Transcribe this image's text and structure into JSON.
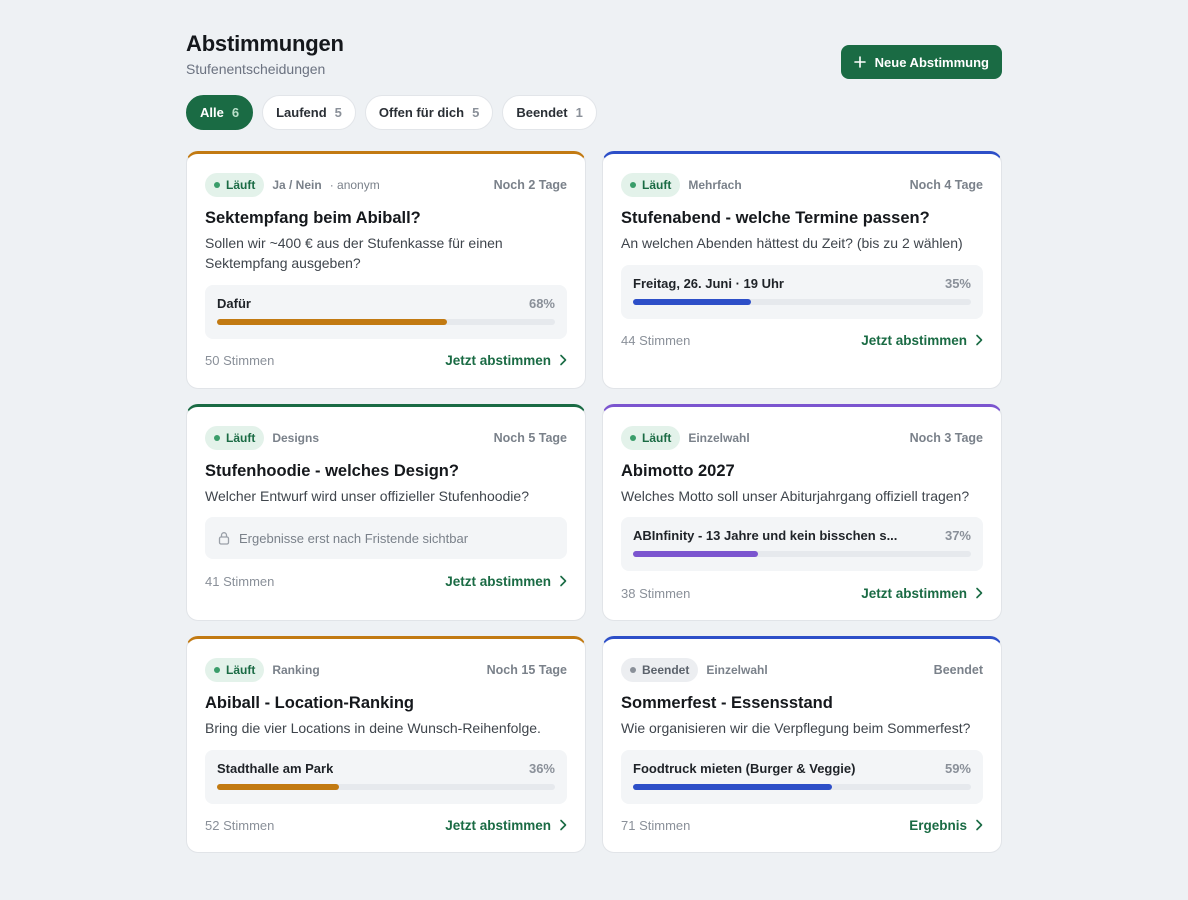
{
  "header": {
    "title": "Abstimmungen",
    "subtitle": "Stufenentscheidungen",
    "new_button": "Neue Abstimmung"
  },
  "filters": [
    {
      "label": "Alle",
      "count": "6",
      "active": true
    },
    {
      "label": "Laufend",
      "count": "5",
      "active": false
    },
    {
      "label": "Offen für dich",
      "count": "5",
      "active": false
    },
    {
      "label": "Beendet",
      "count": "1",
      "active": false
    }
  ],
  "colors": {
    "brand": "#1a6b44",
    "orange": "#c27a12",
    "blue": "#2d4fc8",
    "green": "#1a6b44",
    "purple": "#7b55cf"
  },
  "polls": [
    {
      "status": "Läuft",
      "type": "Ja / Nein",
      "anon": "· anonym",
      "deadline": "Noch 2 Tage",
      "title": "Sektempfang beim Abiball?",
      "description": "Sollen wir ~400 € aus der Stufenkasse für einen Sektempfang ausgeben?",
      "result_label": "Dafür",
      "result_pct": "68%",
      "result_value": 0.68,
      "votes": "50 Stimmen",
      "cta": "Jetzt abstimmen"
    },
    {
      "status": "Läuft",
      "type": "Mehrfach",
      "deadline": "Noch 4 Tage",
      "title": "Stufenabend - welche Termine passen?",
      "description": "An welchen Abenden hättest du Zeit? (bis zu 2 wählen)",
      "result_label": "Freitag, 26. Juni · 19 Uhr",
      "result_pct": "35%",
      "result_value": 0.35,
      "votes": "44 Stimmen",
      "cta": "Jetzt abstimmen"
    },
    {
      "status": "Läuft",
      "type": "Designs",
      "deadline": "Noch 5 Tage",
      "title": "Stufenhoodie - welches Design?",
      "description": "Welcher Entwurf wird unser offizieller Stufenhoodie?",
      "locked_text": "Ergebnisse erst nach Fristende sichtbar",
      "votes": "41 Stimmen",
      "cta": "Jetzt abstimmen"
    },
    {
      "status": "Läuft",
      "type": "Einzelwahl",
      "deadline": "Noch 3 Tage",
      "title": "Abimotto 2027",
      "description": "Welches Motto soll unser Abiturjahrgang offiziell tragen?",
      "result_label": "ABInfinity - 13 Jahre und kein bisschen s...",
      "result_pct": "37%",
      "result_value": 0.37,
      "votes": "38 Stimmen",
      "cta": "Jetzt abstimmen"
    },
    {
      "status": "Läuft",
      "type": "Ranking",
      "deadline": "Noch 15 Tage",
      "title": "Abiball - Location-Ranking",
      "description": "Bring die vier Locations in deine Wunsch-Reihenfolge.",
      "result_label": "Stadthalle am Park",
      "result_pct": "36%",
      "result_value": 0.36,
      "votes": "52 Stimmen",
      "cta": "Jetzt abstimmen"
    },
    {
      "status": "Beendet",
      "type": "Einzelwahl",
      "deadline": "Beendet",
      "title": "Sommerfest - Essensstand",
      "description": "Wie organisieren wir die Verpflegung beim Sommerfest?",
      "result_label": "Foodtruck mieten (Burger & Veggie)",
      "result_pct": "59%",
      "result_value": 0.59,
      "votes": "71 Stimmen",
      "cta": "Ergebnis"
    }
  ]
}
